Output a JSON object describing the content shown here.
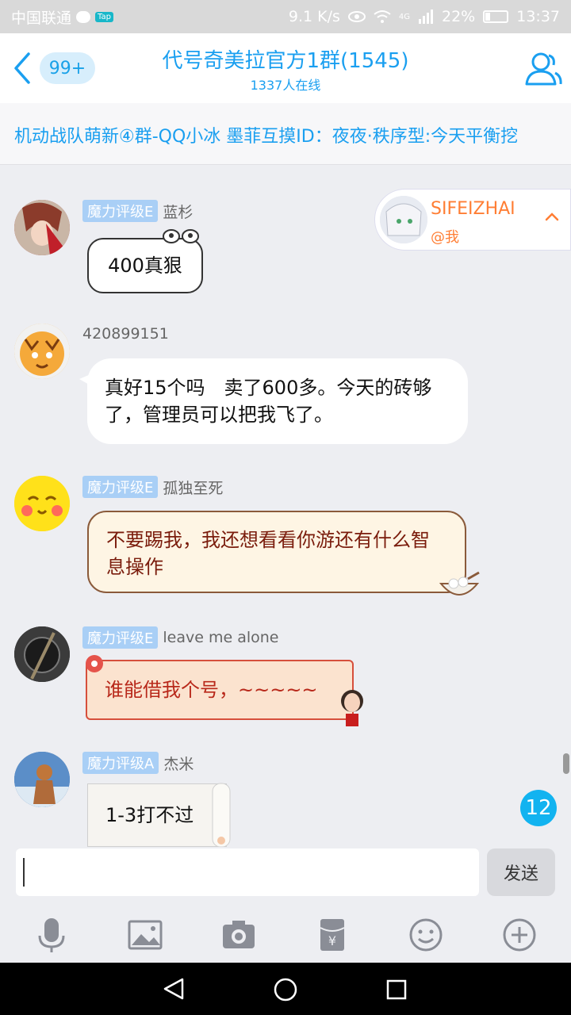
{
  "status_bar": {
    "carrier": "中国联通",
    "tap_badge": "Tap",
    "net_speed": "9.1 K/s",
    "signal": "4G",
    "battery": "22%",
    "time": "13:37"
  },
  "header": {
    "unread_badge": "99+",
    "title": "代号奇美拉官方1群(1545)",
    "online": "1337人在线"
  },
  "notice": {
    "text": "机动战队萌新④群-QQ小冰 墨菲互摸ID：夜夜·秩序型:今天平衡挖"
  },
  "messages": [
    {
      "level": "魔力评级E",
      "name": "蓝杉",
      "text": "400真狠"
    },
    {
      "level": "",
      "name": "420899151",
      "text": "真好15个吗　卖了600多。今天的砖够了，管理员可以把我飞了。"
    },
    {
      "level": "魔力评级E",
      "name": "孤独至死",
      "text": "不要踢我，我还想看看你游还有什么智息操作"
    },
    {
      "level": "魔力评级E",
      "name": "leave me alone",
      "text": "谁能借我个号，~~~~~"
    },
    {
      "level": "魔力评级A",
      "name": "杰米",
      "text": "1-3打不过"
    }
  ],
  "mention_card": {
    "name": "SIFEIZHAI",
    "at": "@我"
  },
  "new_message_count": "12",
  "input": {
    "value": "",
    "send_label": "发送"
  },
  "colors": {
    "accent": "#1a9ff0",
    "mention": "#ff7e34",
    "level_badge": "#a9cff6"
  },
  "icons": [
    "back-icon",
    "members-icon",
    "mic-icon",
    "image-icon",
    "camera-icon",
    "red-packet-icon",
    "emoji-icon",
    "plus-icon",
    "nav-back-icon",
    "nav-home-icon",
    "nav-recents-icon"
  ]
}
